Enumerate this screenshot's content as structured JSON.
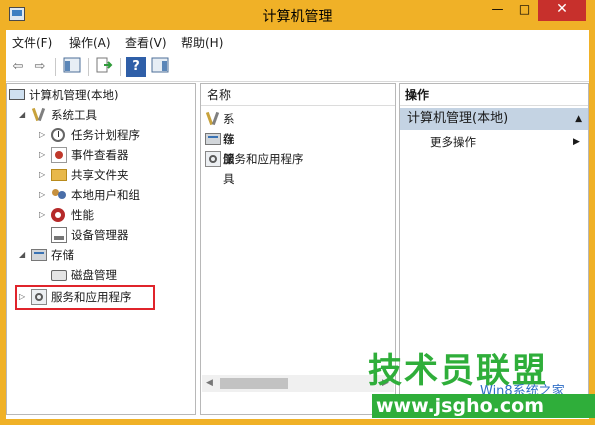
{
  "window": {
    "title": "计算机管理",
    "min_label": "—",
    "max_label": "□",
    "close_label": "✕"
  },
  "menu": [
    {
      "label": "文件(F)"
    },
    {
      "label": "操作(A)"
    },
    {
      "label": "查看(V)"
    },
    {
      "label": "帮助(H)"
    }
  ],
  "toolbar": {
    "back_icon": "back-arrow-icon",
    "forward_icon": "forward-arrow-icon",
    "back_glyph": "⇦",
    "forward_glyph": "⇨",
    "help_glyph": "?"
  },
  "tree": {
    "root": "计算机管理(本地)",
    "system_tools": "系统工具",
    "task_scheduler": "任务计划程序",
    "event_viewer": "事件查看器",
    "shared_folders": "共享文件夹",
    "local_users": "本地用户和组",
    "performance": "性能",
    "device_manager": "设备管理器",
    "storage": "存储",
    "disk_management": "磁盘管理",
    "services_apps": "服务和应用程序",
    "expanded_glyph": "◢",
    "collapsed_glyph": "▷"
  },
  "list": {
    "header": "名称",
    "items": [
      {
        "label": "系统工具"
      },
      {
        "label": "存储"
      },
      {
        "label": "服务和应用程序"
      }
    ],
    "scroll_left": "◀",
    "scroll_right": "▶"
  },
  "actions": {
    "header": "操作",
    "section_title": "计算机管理(本地)",
    "section_arrow": "▲",
    "item": "更多操作",
    "item_arrow": "▶"
  },
  "watermark": {
    "title": "技术员联盟",
    "url": "www.jsgho.com",
    "small": "Win8系统之家"
  },
  "colors": {
    "titlebar": "#f0b127",
    "close_button": "#c7302c",
    "action_section": "#c4d3e3",
    "highlight_box": "#e0242b",
    "watermark_green": "#2fae3a"
  }
}
